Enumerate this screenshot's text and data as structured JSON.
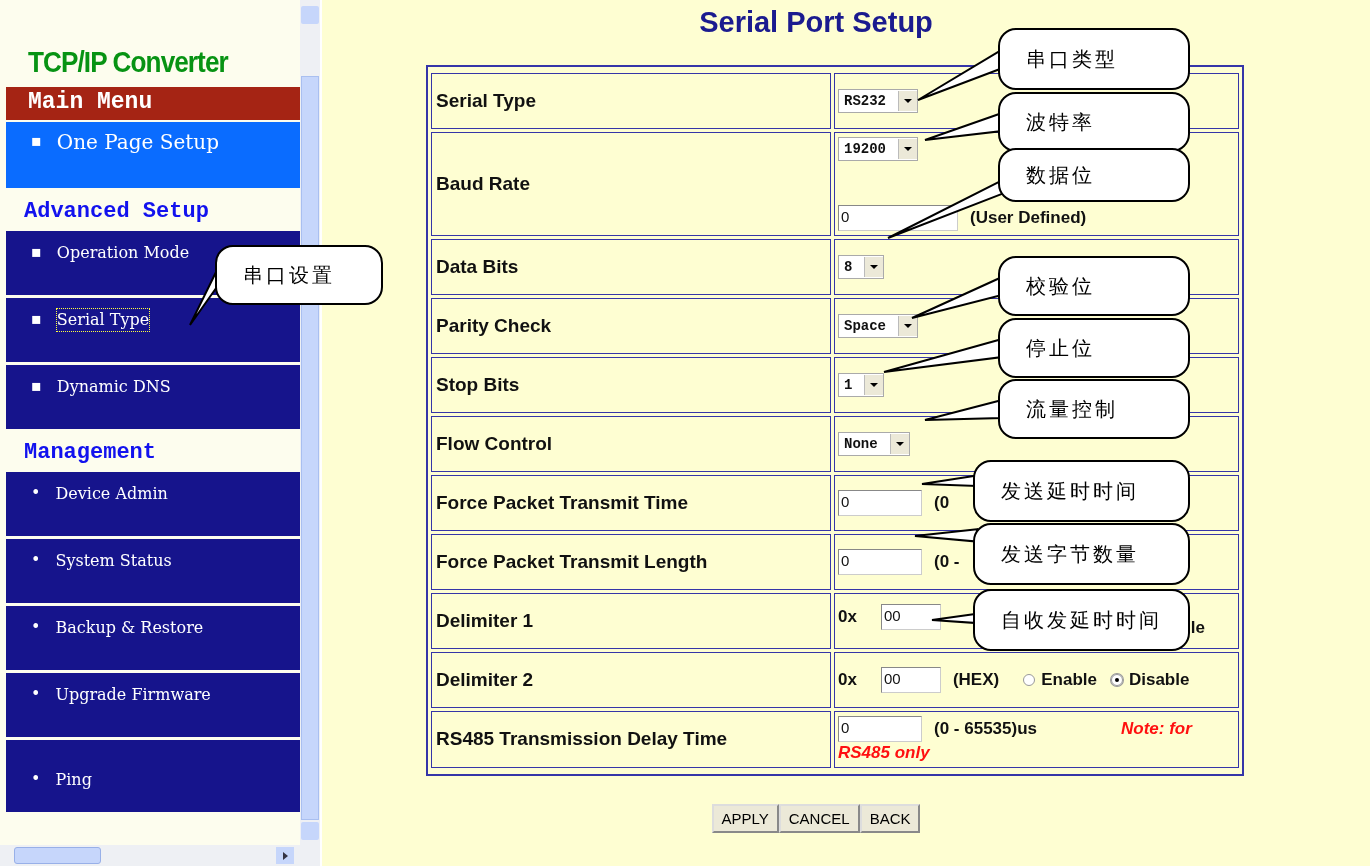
{
  "sidebar": {
    "logo": "TCP/IP Converter",
    "sections": [
      {
        "kind": "banner",
        "title": "Main Menu",
        "bullet": "▪",
        "items": [
          {
            "label": "One Page Setup",
            "selected": true,
            "focused": false
          }
        ]
      },
      {
        "kind": "heading",
        "title": "Advanced Setup",
        "bullet": "▪",
        "items": [
          {
            "label": "Operation Mode",
            "selected": false,
            "focused": false
          },
          {
            "label": "Serial Type",
            "selected": false,
            "focused": true
          },
          {
            "label": "Dynamic DNS",
            "selected": false,
            "focused": false
          }
        ]
      },
      {
        "kind": "heading",
        "title": "Management",
        "bullet": "•",
        "items": [
          {
            "label": "Device Admin",
            "selected": false,
            "focused": false
          },
          {
            "label": "System Status",
            "selected": false,
            "focused": false
          },
          {
            "label": "Backup & Restore",
            "selected": false,
            "focused": false
          },
          {
            "label": "Upgrade Firmware",
            "selected": false,
            "focused": false
          },
          {
            "label": "Ping",
            "selected": false,
            "focused": false
          }
        ]
      }
    ]
  },
  "page_title": "Serial Port Setup",
  "form": [
    {
      "label": "Serial Type",
      "controls": [
        {
          "kind": "select",
          "value": "RS232"
        }
      ]
    },
    {
      "label": "Baud Rate",
      "controls": [
        {
          "kind": "select",
          "value": "19200"
        },
        {
          "kind": "break"
        },
        {
          "kind": "input",
          "value": "0"
        },
        {
          "kind": "text",
          "text": "(User Defined)"
        }
      ]
    },
    {
      "label": "Data Bits",
      "controls": [
        {
          "kind": "select",
          "value": "8"
        }
      ]
    },
    {
      "label": "Parity Check",
      "controls": [
        {
          "kind": "select",
          "value": "Space"
        }
      ]
    },
    {
      "label": "Stop Bits",
      "controls": [
        {
          "kind": "select",
          "value": "1"
        }
      ]
    },
    {
      "label": "Flow Control",
      "controls": [
        {
          "kind": "select",
          "value": "None"
        }
      ]
    },
    {
      "label": "Force Packet Transmit Time",
      "controls": [
        {
          "kind": "input",
          "value": "0"
        },
        {
          "kind": "text",
          "text": "(0"
        }
      ]
    },
    {
      "label": "Force Packet Transmit Length",
      "controls": [
        {
          "kind": "input",
          "value": "0"
        },
        {
          "kind": "text",
          "text": "(0 -"
        }
      ]
    },
    {
      "label": "Delimiter 1",
      "controls": [
        {
          "kind": "text",
          "text": "0x"
        },
        {
          "kind": "input",
          "value": "00"
        },
        {
          "kind": "tail",
          "text": "le"
        }
      ]
    },
    {
      "label": "Delimiter 2",
      "controls": [
        {
          "kind": "text",
          "text": "0x"
        },
        {
          "kind": "input",
          "value": "00"
        },
        {
          "kind": "text",
          "text": "(HEX)"
        },
        {
          "kind": "radio",
          "label": "Enable",
          "selected": false
        },
        {
          "kind": "radio",
          "label": "Disable",
          "selected": true
        }
      ]
    },
    {
      "label": "RS485 Transmission Delay Time",
      "controls": [
        {
          "kind": "input",
          "value": "0"
        },
        {
          "kind": "text",
          "text": "(0 - 65535)us"
        },
        {
          "kind": "note",
          "text": "Note: for"
        },
        {
          "kind": "break"
        },
        {
          "kind": "note",
          "text": "RS485 only"
        }
      ]
    }
  ],
  "buttons": [
    "APPLY",
    "CANCEL",
    "BACK"
  ],
  "callouts": [
    {
      "text": "串口设置"
    },
    {
      "text": "串口类型"
    },
    {
      "text": "波特率"
    },
    {
      "text": "数据位"
    },
    {
      "text": "校验位"
    },
    {
      "text": "停止位"
    },
    {
      "text": "流量控制"
    },
    {
      "text": "发送延时时间"
    },
    {
      "text": "发送字节数量"
    },
    {
      "text": "自收发延时时间"
    }
  ]
}
